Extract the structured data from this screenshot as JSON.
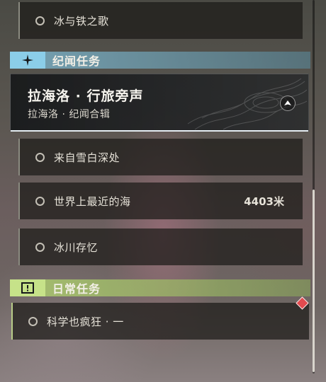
{
  "quests": {
    "top_item": {
      "label": "冰与铁之歌"
    },
    "legend_section": {
      "title": "纪闻任务",
      "icon": "sparkle-star-icon",
      "accent_color": "#8ed4f0"
    },
    "featured": {
      "title": "拉海洛 · 行旅旁声",
      "subtitle": "拉海洛 · 纪闻合辑",
      "nav_icon": "navigate-arrow-icon"
    },
    "legend_items": [
      {
        "label": "来自雪白深处"
      },
      {
        "label": "世界上最近的海",
        "distance": "4403米"
      },
      {
        "label": "冰川存忆"
      }
    ],
    "daily_section": {
      "title": "日常任务",
      "icon": "exclamation-box-icon",
      "accent_color": "#c9e68a"
    },
    "daily_items": [
      {
        "label": "科学也疯狂 · 一",
        "marker": "red-diamond-marker-icon"
      }
    ]
  }
}
